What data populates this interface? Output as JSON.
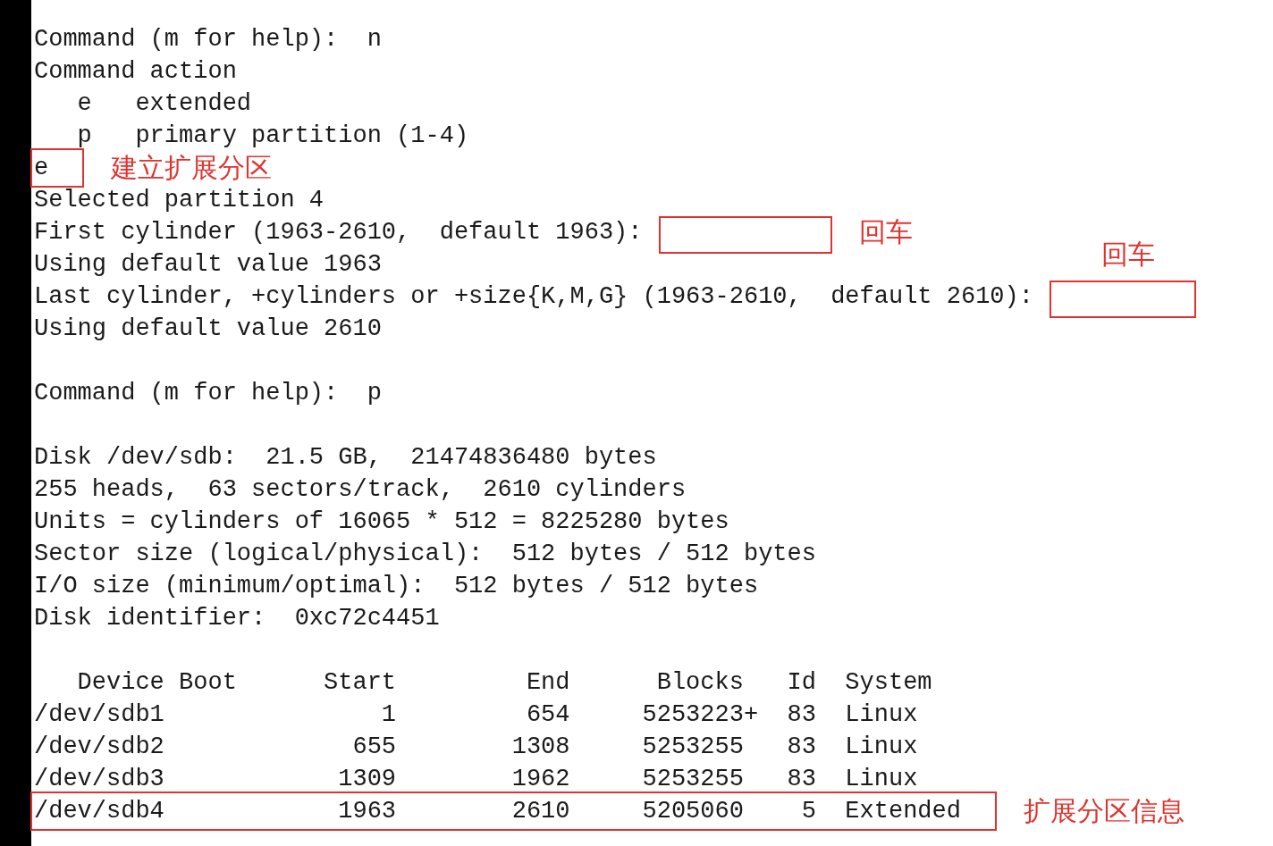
{
  "terminal": {
    "lines": [
      {
        "text": "Command (m for help):  n"
      },
      {
        "text": "Command action"
      },
      {
        "text": "   e   extended"
      },
      {
        "text": "   p   primary partition (1-4)"
      },
      {
        "text": "e",
        "highlight": true,
        "note": {
          "kind": "right",
          "label": "建立扩展分区"
        }
      },
      {
        "text": "Selected partition 4"
      },
      {
        "text": "First cylinder (1963-2610,  default 1963):",
        "answer_box": true,
        "note": {
          "kind": "right",
          "label": "回车"
        }
      },
      {
        "text": "Using default value 1963"
      },
      {
        "text": "Last cylinder, +cylinders or +size{K,M,G} (1963-2610,  default 2610):",
        "answer_box": true,
        "note": {
          "kind": "above",
          "label": "回车"
        }
      },
      {
        "text": "Using default value 2610"
      },
      {
        "text": "Command (m for help):  p",
        "blank_before": true
      },
      {
        "text": "Disk /dev/sdb:  21.5 GB,  21474836480 bytes",
        "blank_before": true
      },
      {
        "text": "255 heads,  63 sectors/track,  2610 cylinders"
      },
      {
        "text": "Units = cylinders of 16065 * 512 = 8225280 bytes"
      },
      {
        "text": "Sector size (logical/physical):  512 bytes / 512 bytes"
      },
      {
        "text": "I/O size (minimum/optimal):  512 bytes / 512 bytes"
      },
      {
        "text": "Disk identifier:  0xc72c4451"
      },
      {
        "text": "   Device Boot      Start         End      Blocks   Id  System",
        "blank_before": true
      },
      {
        "text": "/dev/sdb1               1         654     5253223+  83  Linux"
      },
      {
        "text": "/dev/sdb2             655        1308     5253255   83  Linux"
      },
      {
        "text": "/dev/sdb3            1309        1962     5253255   83  Linux"
      },
      {
        "text": "/dev/sdb4            1963        2610     5205060    5  Extended",
        "highlight": true,
        "note": {
          "kind": "right",
          "label": "扩展分区信息"
        }
      }
    ]
  }
}
